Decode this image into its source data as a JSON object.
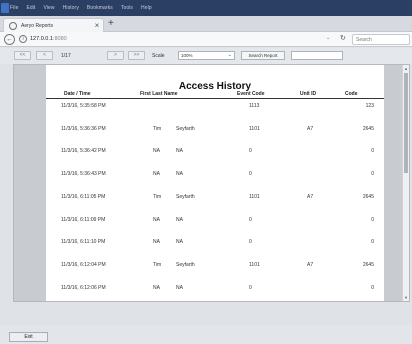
{
  "browser": {
    "menu": [
      "File",
      "Edit",
      "View",
      "History",
      "Bookmarks",
      "Tools",
      "Help"
    ],
    "tab_title": "Aeryo Reports",
    "tab_close": "×",
    "new_tab": "+",
    "url_host": "127.0.0.1",
    "url_port": ":8080",
    "search_placeholder": "Search"
  },
  "toolbar": {
    "first_btn": "<<",
    "prev_btn": "<",
    "page_indicator": "1/17",
    "next_btn": ">",
    "last_btn": ">>",
    "scale_label": "Scale",
    "scale_value": "100%",
    "search_button": "Search Report",
    "search_value": ""
  },
  "report": {
    "title": "Access History",
    "columns": [
      "Date / Time",
      "First Last Name",
      "Event Code",
      "Unit ID",
      "Code"
    ],
    "rows": [
      {
        "datetime": "11/3/16, 5:35:58 PM",
        "first": "",
        "last": "",
        "event": "1113",
        "unit": "",
        "code": "123"
      },
      {
        "datetime": "11/3/16, 5:36:36 PM",
        "first": "Tim",
        "last": "Seyfarth",
        "event": "1101",
        "unit": "A7",
        "code": "2645"
      },
      {
        "datetime": "11/3/16, 5:36:42 PM",
        "first": "NA",
        "last": "NA",
        "event": "0",
        "unit": "",
        "code": "0"
      },
      {
        "datetime": "11/3/16, 5:36:43 PM",
        "first": "NA",
        "last": "NA",
        "event": "0",
        "unit": "",
        "code": "0"
      },
      {
        "datetime": "11/3/16, 6:11:05 PM",
        "first": "Tim",
        "last": "Seyfarth",
        "event": "1101",
        "unit": "A7",
        "code": "2645"
      },
      {
        "datetime": "11/3/16, 6:11:09 PM",
        "first": "NA",
        "last": "NA",
        "event": "0",
        "unit": "",
        "code": "0"
      },
      {
        "datetime": "11/3/16, 6:11:10 PM",
        "first": "NA",
        "last": "NA",
        "event": "0",
        "unit": "",
        "code": "0"
      },
      {
        "datetime": "11/3/16, 6:12:04 PM",
        "first": "Tim",
        "last": "Seyfarth",
        "event": "1101",
        "unit": "A7",
        "code": "2645"
      },
      {
        "datetime": "11/3/16, 6:12:06 PM",
        "first": "NA",
        "last": "NA",
        "event": "0",
        "unit": "",
        "code": "0"
      }
    ]
  },
  "footer": {
    "exit_button": "Exit"
  }
}
